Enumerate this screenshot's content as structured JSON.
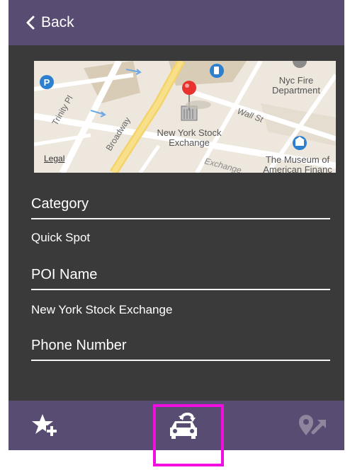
{
  "header": {
    "back_label": "Back"
  },
  "map": {
    "street_labels": [
      "Trinity Pl",
      "Broadway",
      "Wall St",
      "Exchange"
    ],
    "place_labels": [
      "New York Stock Exchange",
      "Nyc Fire Department",
      "The Museum of American Finance"
    ],
    "place_label_lines": {
      "nyse": [
        "New York Stock",
        "Exchange"
      ],
      "fire": [
        "Nyc Fire",
        "Department"
      ],
      "museum": [
        "The Museum of",
        "American Financ"
      ]
    },
    "legal_label": "Legal",
    "pin_color": "#e8322e"
  },
  "form": {
    "category_label": "Category",
    "category_value": "Quick Spot",
    "poi_label": "POI Name",
    "poi_value": "New York Stock Exchange",
    "phone_label": "Phone Number",
    "phone_value": ""
  },
  "bottom_bar": {
    "items": [
      {
        "icon": "star-add-icon"
      },
      {
        "icon": "car-share-icon",
        "selected": true
      },
      {
        "icon": "location-arrow-icon"
      }
    ],
    "highlight_color": "#f20ee0"
  },
  "colors": {
    "header_bg": "#594c72",
    "body_bg": "#3a3a3a",
    "text": "#ffffff"
  }
}
